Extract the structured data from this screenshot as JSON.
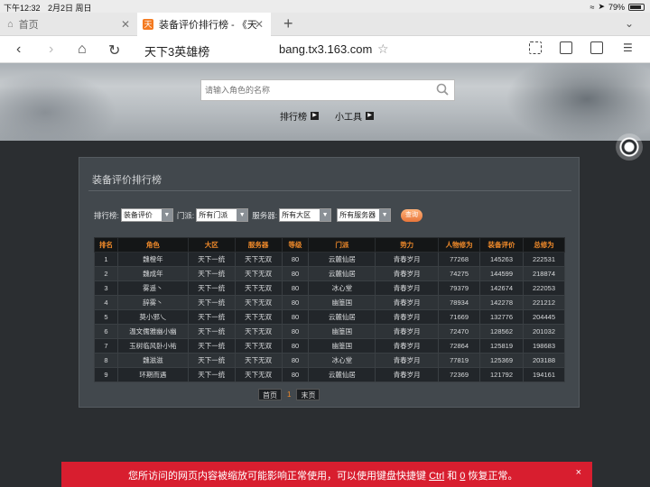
{
  "status": {
    "time": "下午12:32",
    "date": "2月2日 周日",
    "battery": "79%"
  },
  "tabs": [
    {
      "label": "首页"
    },
    {
      "label": "装备评价排行榜 - 《天",
      "favicon": "天"
    }
  ],
  "address": {
    "page_title": "天下3英雄榜",
    "url": "bang.tx3.163.com"
  },
  "hero": {
    "search_placeholder": "请输入角色的名称",
    "nav": [
      "排行榜",
      "小工具"
    ]
  },
  "panel": {
    "title": "装备评价排行榜",
    "filters": {
      "rank_label": "排行榜:",
      "rank_value": "装备评价",
      "sect_label": "门派:",
      "sect_value": "所有门派",
      "server_label": "服务器:",
      "region_value": "所有大区",
      "server_value": "所有服务器",
      "query_button": "查询"
    },
    "table": {
      "headers": [
        "排名",
        "角色",
        "大区",
        "服务器",
        "等级",
        "门派",
        "势力",
        "人物修为",
        "装备评价",
        "总修为"
      ],
      "rows": [
        [
          "1",
          "魏橙年",
          "天下一统",
          "天下无双",
          "80",
          "云麓仙居",
          "青春岁月",
          "77268",
          "145263",
          "222531"
        ],
        [
          "2",
          "魏成年",
          "天下一统",
          "天下无双",
          "80",
          "云麓仙居",
          "青春岁月",
          "74275",
          "144599",
          "218874"
        ],
        [
          "3",
          "雾遥丶",
          "天下一统",
          "天下无双",
          "80",
          "冰心堂",
          "青春岁月",
          "79379",
          "142674",
          "222053"
        ],
        [
          "4",
          "辞雾丶",
          "天下一统",
          "天下无双",
          "80",
          "幽篁国",
          "青春岁月",
          "78934",
          "142278",
          "221212"
        ],
        [
          "5",
          "莫小邪乀",
          "天下一统",
          "天下无双",
          "80",
          "云麓仙居",
          "青春岁月",
          "71669",
          "132776",
          "204445"
        ],
        [
          "6",
          "温文儒雅幽小幽",
          "天下一统",
          "天下无双",
          "80",
          "幽篁国",
          "青春岁月",
          "72470",
          "128562",
          "201032"
        ],
        [
          "7",
          "玉树临风卧小祐",
          "天下一统",
          "天下无双",
          "80",
          "幽篁国",
          "青春岁月",
          "72864",
          "125819",
          "198683"
        ],
        [
          "8",
          "魏滋滋",
          "天下一统",
          "天下无双",
          "80",
          "冰心堂",
          "青春岁月",
          "77819",
          "125369",
          "203188"
        ],
        [
          "9",
          "环期而遇",
          "天下一统",
          "天下无双",
          "80",
          "云麓仙居",
          "青春岁月",
          "72369",
          "121792",
          "194161"
        ]
      ]
    },
    "pager": {
      "first": "首页",
      "current": "1",
      "last": "末页"
    }
  },
  "notice": {
    "text_before": "您所访问的网页内容被缩放可能影响正常使用，可以使用键盘快捷键 ",
    "key1": "Ctrl",
    "text_mid": " 和 ",
    "key2": "0",
    "text_after": " 恢复正常。",
    "close": "×"
  },
  "colors": {
    "accent": "#f08a2a",
    "notice_bg": "#d81e2f",
    "panel_bg": "#42484d"
  }
}
